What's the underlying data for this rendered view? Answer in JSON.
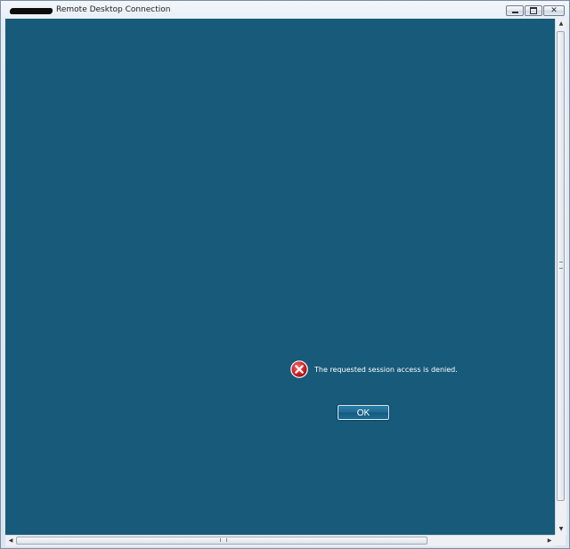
{
  "window": {
    "title": "Remote Desktop Connection",
    "caption_buttons": {
      "minimize": "minimize-icon",
      "maximize": "maximize-icon",
      "close": "close-icon"
    }
  },
  "dialog": {
    "message": "The requested session access is denied.",
    "ok_label": "OK",
    "icon": "error-icon"
  },
  "scrollbars": {
    "vertical": {
      "up": "▲",
      "down": "▼"
    },
    "horizontal": {
      "left": "◀",
      "right": "▶"
    }
  },
  "colors": {
    "client_background": "#175a7a",
    "error_red": "#d8242c"
  }
}
